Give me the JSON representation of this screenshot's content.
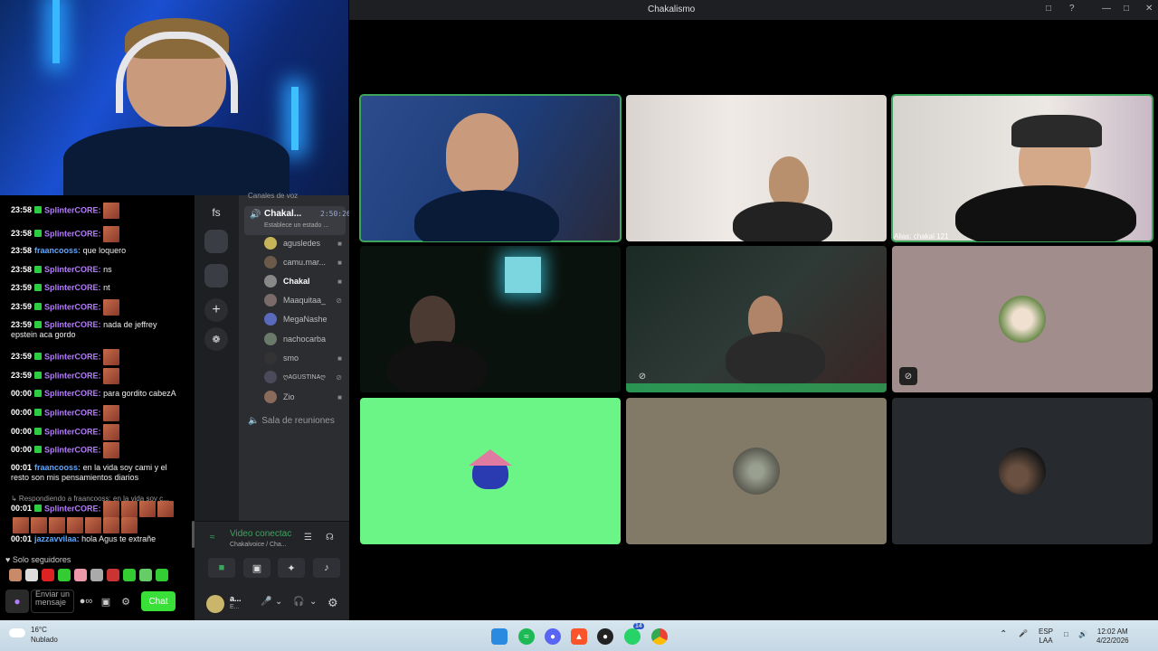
{
  "window": {
    "title": "Chakalismo"
  },
  "chat": {
    "messages": [
      {
        "ts": "23:58",
        "user": "SplinterCORE:",
        "text": "",
        "emotes": 1
      },
      {
        "ts": "23:58",
        "user": "SplinterCORE:",
        "text": "",
        "emotes": 1
      },
      {
        "ts": "23:58",
        "user": "fraancooss:",
        "text": "que loquero",
        "emotes": 0
      },
      {
        "ts": "23:58",
        "user": "SplinterCORE:",
        "text": "ns",
        "emotes": 0
      },
      {
        "ts": "23:59",
        "user": "SplinterCORE:",
        "text": "nt",
        "emotes": 0
      },
      {
        "ts": "23:59",
        "user": "SplinterCORE:",
        "text": "",
        "emotes": 1
      },
      {
        "ts": "23:59",
        "user": "SplinterCORE:",
        "text": "nada de jeffrey epstein aca gordo",
        "emotes": 0
      },
      {
        "ts": "23:59",
        "user": "SplinterCORE:",
        "text": "",
        "emotes": 1
      },
      {
        "ts": "23:59",
        "user": "SplinterCORE:",
        "text": "",
        "emotes": 1
      },
      {
        "ts": "00:00",
        "user": "SplinterCORE:",
        "text": "para gordito cabezA",
        "emotes": 0
      },
      {
        "ts": "00:00",
        "user": "SplinterCORE:",
        "text": "",
        "emotes": 1
      },
      {
        "ts": "00:00",
        "user": "SplinterCORE:",
        "text": "",
        "emotes": 1
      },
      {
        "ts": "00:00",
        "user": "SplinterCORE:",
        "text": "",
        "emotes": 1
      },
      {
        "ts": "00:01",
        "user": "fraancooss:",
        "text": "en la vida soy cami y el resto son mis pensamientos diarios",
        "emotes": 0
      },
      {
        "ts": "00:01",
        "user": "SplinterCORE:",
        "text": "",
        "emotes": 10
      },
      {
        "ts": "00:01",
        "user": "jazzavvilaa:",
        "text": "hola Agus te extrañe",
        "emotes": 0
      }
    ],
    "reply_to": "↳ Respondiendo a fraancooss: en la vida soy c...",
    "followers_only": "♥ Solo seguidores",
    "input_placeholder": "Enviar un mensaje",
    "send_label": "Chat"
  },
  "discord": {
    "server_label": "fs",
    "category": "Canales de voz",
    "voice_channel": {
      "name": "Chakal...",
      "time": "2:50:26",
      "status": "Establece un estado ..."
    },
    "members": [
      {
        "name": "agusledes",
        "color": "#c6b35a"
      },
      {
        "name": "camu.mar...",
        "color": "#6b5a4a"
      },
      {
        "name": "Chakal",
        "color": "#888"
      },
      {
        "name": "Maaquitaa_",
        "color": "#7a6a6a"
      },
      {
        "name": "MegaNashe",
        "color": "#5a6aba"
      },
      {
        "name": "nachocarba",
        "color": "#6a7a6a"
      },
      {
        "name": "smo",
        "color": "#333"
      },
      {
        "name": "ღAGUSTINAღ",
        "color": "#4a4a5a"
      },
      {
        "name": "Zio",
        "color": "#8a6a5a"
      }
    ],
    "stage_channel": "Sala de reuniones",
    "connection": {
      "title": "Video conectac",
      "subtitle": "Chakalvoice / Cha..."
    },
    "user": {
      "name": "a...",
      "status": "E..."
    }
  },
  "tiles": [
    {
      "alias": "",
      "muted": false
    },
    {
      "alias": "",
      "muted": false
    },
    {
      "alias": "Alias: chakal 121",
      "muted": false
    },
    {
      "alias": "",
      "muted": false
    },
    {
      "alias": "",
      "muted": true
    },
    {
      "alias": "",
      "muted": true
    },
    {
      "alias": "",
      "muted": false
    },
    {
      "alias": "",
      "muted": false
    },
    {
      "alias": "",
      "muted": false
    }
  ],
  "taskbar": {
    "temp": "16°C",
    "condition": "Nublado",
    "lang1": "ESP",
    "lang2": "LAA",
    "time": "12:02 AM",
    "date": "4/22/2026",
    "badge_whatsapp": "14"
  }
}
